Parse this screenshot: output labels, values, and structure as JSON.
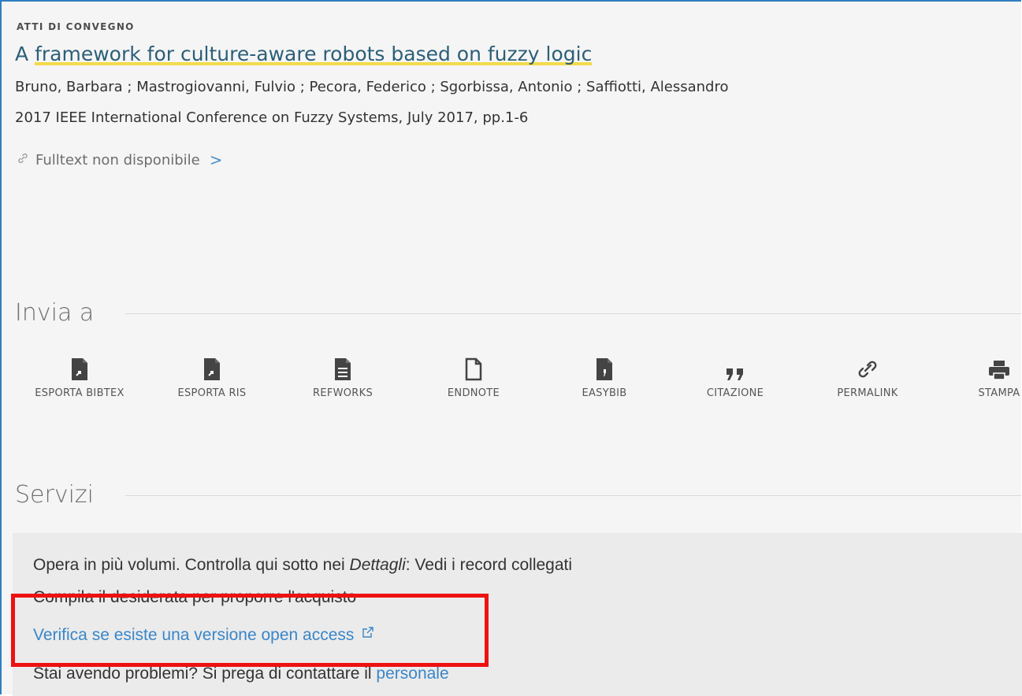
{
  "record": {
    "type_label": "ATTI DI CONVEGNO",
    "title_prefix": "A ",
    "title_link": "framework for culture-aware robots based on fuzzy logic",
    "authors": "Bruno, Barbara ; Mastrogiovanni, Fulvio ; Pecora, Federico ; Sgorbissa, Antonio ; Saffiotti, Alessandro",
    "source": "2017 IEEE International Conference on Fuzzy Systems, July 2017, pp.1-6",
    "fulltext": "Fulltext non disponibile",
    "fulltext_chevron": ">"
  },
  "send_to": {
    "heading": "Invia a",
    "actions": [
      {
        "label": "ESPORTA BIBTEX",
        "icon": "file-export-icon"
      },
      {
        "label": "ESPORTA RIS",
        "icon": "file-export-icon"
      },
      {
        "label": "REFWORKS",
        "icon": "file-text-icon"
      },
      {
        "label": "ENDNOTE",
        "icon": "file-outline-icon"
      },
      {
        "label": "EASYBIB",
        "icon": "file-quote-icon"
      },
      {
        "label": "CITAZIONE",
        "icon": "quote-icon"
      },
      {
        "label": "PERMALINK",
        "icon": "link-icon"
      },
      {
        "label": "STAMPA",
        "icon": "print-icon"
      }
    ]
  },
  "services": {
    "heading": "Servizi",
    "line1_prefix": "Opera in più volumi. Controlla qui sotto nei ",
    "line1_em": "Dettagli",
    "line1_suffix": ": Vedi i record collegati",
    "line2": "Compila il desiderata per proporre l'acquisto",
    "line3_link": "Verifica se esiste una versione open access",
    "line4_prefix": "Stai avendo problemi? Si prega di contattare il ",
    "line4_link": "personale"
  },
  "colors": {
    "accent": "#2f7fc1",
    "title": "#2c5f78",
    "highlight": "#f2da4a",
    "link": "#3a86c8",
    "annotation": "#ee1111"
  }
}
